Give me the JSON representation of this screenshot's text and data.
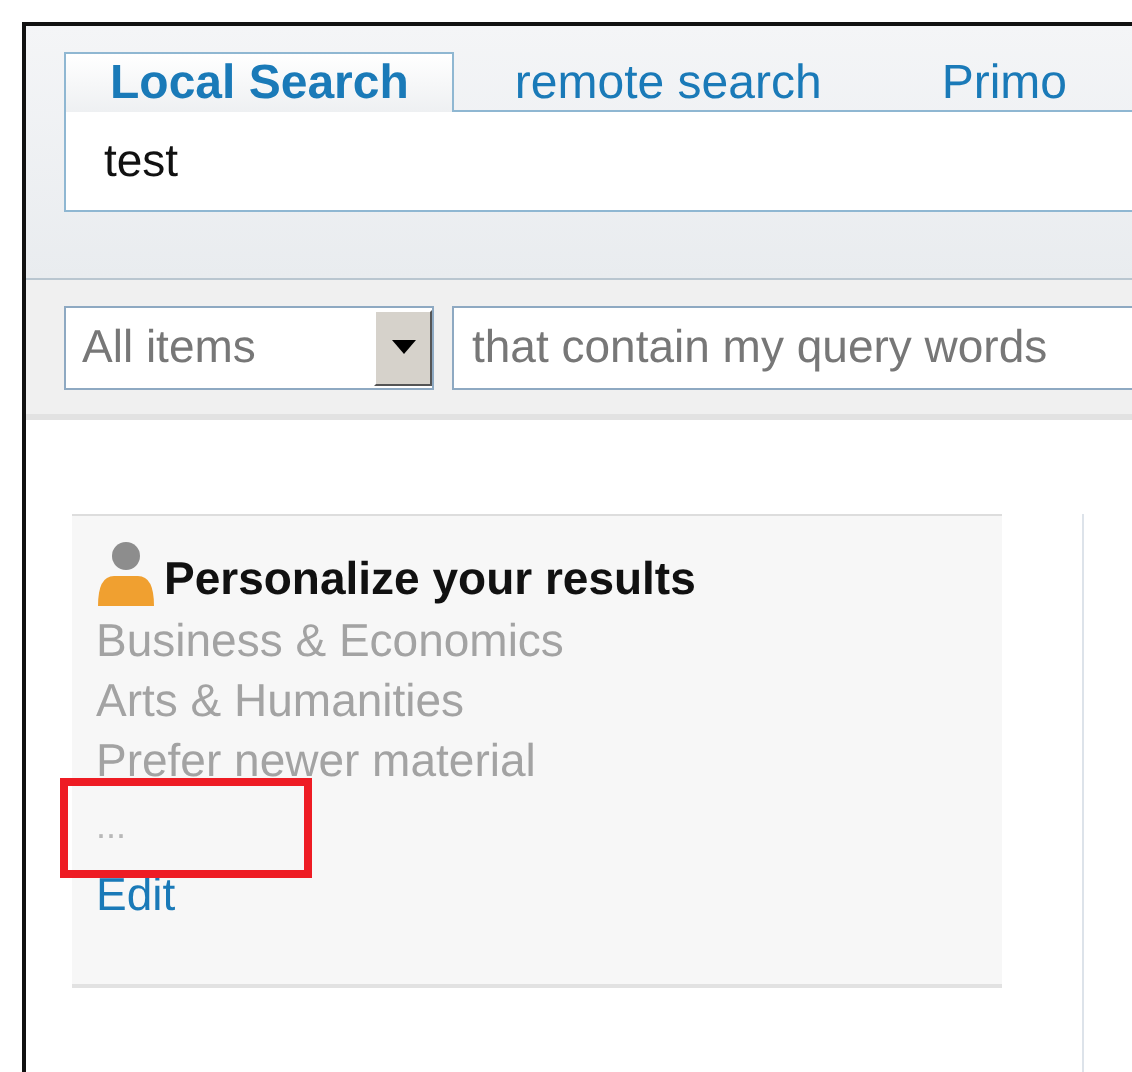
{
  "tabs": [
    {
      "label": "Local Search",
      "selected": true
    },
    {
      "label": "remote search",
      "selected": false
    },
    {
      "label": "Primo",
      "selected": false
    }
  ],
  "search": {
    "value": "test"
  },
  "scope_select": {
    "value": "All items"
  },
  "match_select": {
    "value": "that contain my query words"
  },
  "personalize": {
    "title": "Personalize your results",
    "items": [
      "Business & Economics",
      "Arts & Humanities",
      "Prefer newer material"
    ],
    "more": "...",
    "edit": "Edit"
  }
}
